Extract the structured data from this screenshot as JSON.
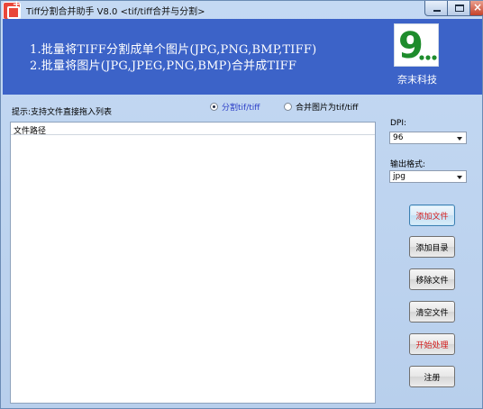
{
  "window": {
    "title": "Tiff分割合并助手 V8.0 <tif/tiff合并与分割>"
  },
  "banner": {
    "line1": "1.批量将TIFF分割成单个图片(JPG,PNG,BMP,TIFF)",
    "line2": "2.批量将图片(JPG,JPEG,PNG,BMP)合并成TIFF",
    "logo_text": "奈末科技",
    "logo_glyph": "9",
    "logo_color": "#1e8c2c"
  },
  "tip": "提示:支持文件直接拖入列表",
  "mode": {
    "split_label": "分割tif/tiff",
    "merge_label": "合并图片为tif/tiff",
    "selected": "split"
  },
  "file_list": {
    "header": "文件路径",
    "rows": []
  },
  "dpi": {
    "label": "DPI:",
    "value": "96"
  },
  "format": {
    "label": "输出格式:",
    "value": "jpg"
  },
  "buttons": {
    "add_file": "添加文件",
    "add_dir": "添加目录",
    "remove_file": "移除文件",
    "clear_files": "清空文件",
    "start": "开始处理",
    "register": "注册"
  },
  "colors": {
    "banner_bg": "#3c63c8",
    "accent_red": "#d21d1d",
    "radio_active": "#2a3cc6"
  }
}
